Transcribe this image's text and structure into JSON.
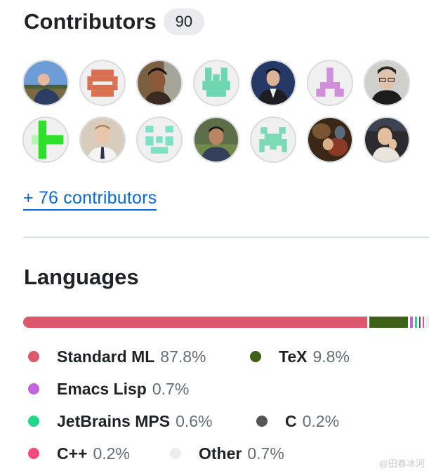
{
  "contributors": {
    "title": "Contributors",
    "count": "90",
    "more_link": "+ 76 contributors",
    "avatars": [
      {
        "name": "avatar-photo-outdoor"
      },
      {
        "name": "avatar-identicon-orange"
      },
      {
        "name": "avatar-photo-smiling"
      },
      {
        "name": "avatar-identicon-mint"
      },
      {
        "name": "avatar-photo-suit"
      },
      {
        "name": "avatar-identicon-lilac"
      },
      {
        "name": "avatar-photo-glasses"
      },
      {
        "name": "avatar-identicon-green"
      },
      {
        "name": "avatar-photo-tie"
      },
      {
        "name": "avatar-identicon-teal"
      },
      {
        "name": "avatar-photo-park"
      },
      {
        "name": "avatar-identicon-invader"
      },
      {
        "name": "avatar-photo-painting"
      },
      {
        "name": "avatar-photo-gesture"
      }
    ]
  },
  "languages": {
    "title": "Languages",
    "items": [
      {
        "name": "Standard ML",
        "percent": "87.8%",
        "share": 87.8,
        "color": "#dc566d"
      },
      {
        "name": "TeX",
        "percent": "9.8%",
        "share": 9.8,
        "color": "#3d6117"
      },
      {
        "name": "Emacs Lisp",
        "percent": "0.7%",
        "share": 0.7,
        "color": "#c065db"
      },
      {
        "name": "JetBrains MPS",
        "percent": "0.6%",
        "share": 0.6,
        "color": "#21d789"
      },
      {
        "name": "C",
        "percent": "0.2%",
        "share": 0.2,
        "color": "#555555"
      },
      {
        "name": "C++",
        "percent": "0.2%",
        "share": 0.2,
        "color": "#f34b7d"
      },
      {
        "name": "Other",
        "percent": "0.7%",
        "share": 0.7,
        "color": "#ededed"
      }
    ]
  },
  "watermark": "@田春冰河"
}
